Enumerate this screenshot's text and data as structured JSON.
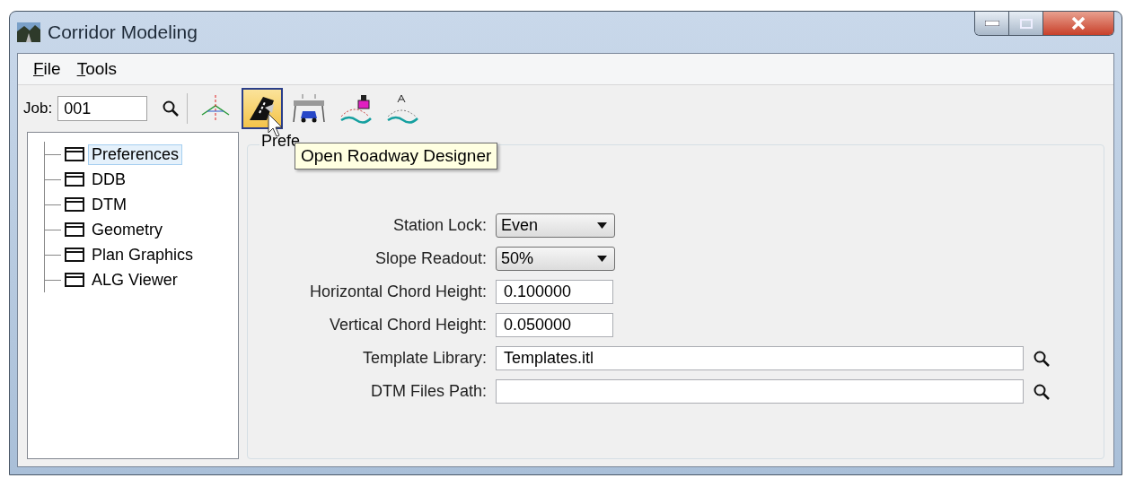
{
  "window": {
    "title": "Corridor Modeling"
  },
  "menu": [
    {
      "label": "File"
    },
    {
      "label": "Tools"
    }
  ],
  "toolbar": {
    "job_label": "Job:",
    "job_value": "001",
    "tools": [
      {
        "kind": "alignment",
        "selected": false
      },
      {
        "kind": "roadway",
        "selected": true
      },
      {
        "kind": "traffic",
        "selected": false
      },
      {
        "kind": "component",
        "selected": false
      },
      {
        "kind": "annotate",
        "selected": false
      }
    ]
  },
  "tooltip": "Open Roadway Designer",
  "tree": [
    {
      "label": "Preferences",
      "selected": true
    },
    {
      "label": "DDB",
      "selected": false
    },
    {
      "label": "DTM",
      "selected": false
    },
    {
      "label": "Geometry",
      "selected": false
    },
    {
      "label": "Plan Graphics",
      "selected": false
    },
    {
      "label": "ALG Viewer",
      "selected": false
    }
  ],
  "group_box": {
    "label": "Prefe"
  },
  "fields": [
    {
      "kind": "dropdown",
      "label": "Station Lock:",
      "value": "Even"
    },
    {
      "kind": "dropdown",
      "label": "Slope Readout:",
      "value": "50%"
    },
    {
      "kind": "text",
      "label": "Horizontal Chord Height:",
      "value": "0.100000"
    },
    {
      "kind": "text",
      "label": "Vertical Chord Height:",
      "value": "0.050000"
    },
    {
      "kind": "path",
      "label": "Template Library:",
      "value": "Templates.itl"
    },
    {
      "kind": "path",
      "label": "DTM Files Path:"
    }
  ]
}
